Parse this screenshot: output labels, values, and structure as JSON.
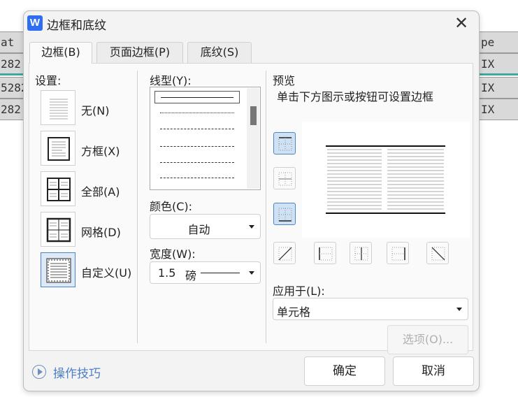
{
  "background": {
    "left_cells": [
      "at",
      "282",
      "5282",
      "282"
    ],
    "right_cells": [
      "pe",
      "IX",
      "IX",
      "IX"
    ]
  },
  "dialog": {
    "title": "边框和底纹",
    "app_icon_letter": "W",
    "close_glyph": "✕",
    "tabs": [
      {
        "label": "边框(B)",
        "active": true
      },
      {
        "label": "页面边框(P)",
        "active": false
      },
      {
        "label": "底纹(S)",
        "active": false
      }
    ]
  },
  "settings": {
    "heading": "设置:",
    "items": [
      {
        "label": "无(N)",
        "selected": false
      },
      {
        "label": "方框(X)",
        "selected": false
      },
      {
        "label": "全部(A)",
        "selected": false
      },
      {
        "label": "网格(D)",
        "selected": false
      },
      {
        "label": "自定义(U)",
        "selected": true
      }
    ]
  },
  "line": {
    "style_heading": "线型(Y):",
    "color_heading": "颜色(C):",
    "color_value": "自动",
    "width_heading": "宽度(W):",
    "width_value": "1.5",
    "width_unit": "磅"
  },
  "preview": {
    "heading": "预览",
    "hint": "单击下方图示或按钮可设置边框",
    "apply_heading": "应用于(L):",
    "apply_value": "单元格",
    "options_button": "选项(O)..."
  },
  "footer": {
    "tips_label": "操作技巧",
    "ok_button": "确定",
    "cancel_button": "取消"
  },
  "colors": {
    "accent": "#4b86c7",
    "tips": "#4d7fc2",
    "app_icon": "#2f6ef2"
  }
}
